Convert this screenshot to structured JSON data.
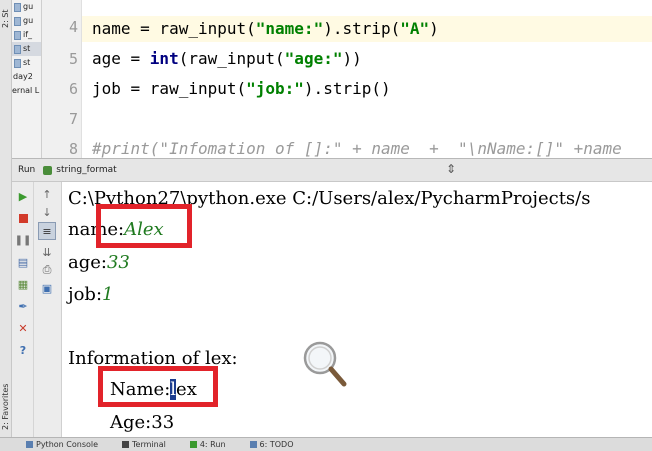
{
  "favorites_strip": {
    "structure_label": "2: St",
    "favorites_label": "2: Favorites"
  },
  "project_tree": {
    "items": [
      {
        "label": "gu"
      },
      {
        "label": "gu"
      },
      {
        "label": "if_"
      },
      {
        "label": "st"
      },
      {
        "label": "st"
      },
      {
        "label": "day2"
      },
      {
        "label": "ernal L"
      }
    ]
  },
  "editor": {
    "lines": [
      {
        "number": "4",
        "text": "name = raw_input(\"name:\").strip(\"A\")"
      },
      {
        "number": "5",
        "text": "age = int(raw_input(\"age:\"))"
      },
      {
        "number": "6",
        "text": "job = raw_input(\"job:\").strip()"
      },
      {
        "number": "7",
        "text": ""
      },
      {
        "number": "8",
        "text": "#print(\"Infomation of []:\" + name  +  \"\\nName:[]\" +name"
      }
    ]
  },
  "run_panel": {
    "title": "Run",
    "tab_label": "string_format"
  },
  "console": {
    "command": "C:\\Python27\\python.exe C:/Users/alex/PycharmProjects/s",
    "prompt_name": "name:",
    "input_name": "Alex",
    "prompt_age": "age:",
    "input_age": "33",
    "prompt_job": "job:",
    "input_job": "1",
    "info_line": "Information of lex:",
    "name_label": "Name:",
    "name_cursor_char": "l",
    "name_rest": "ex",
    "age_line": "Age:33"
  },
  "bottom_bar": {
    "tabs": [
      {
        "label": "Python Console"
      },
      {
        "label": "Terminal"
      },
      {
        "label": "4: Run"
      },
      {
        "label": "6: TODO"
      }
    ]
  },
  "colors": {
    "highlight_box": "#e2232a",
    "string_literal": "#008000",
    "console_input": "#1f7a1f",
    "selection": "#1b3c8f"
  }
}
